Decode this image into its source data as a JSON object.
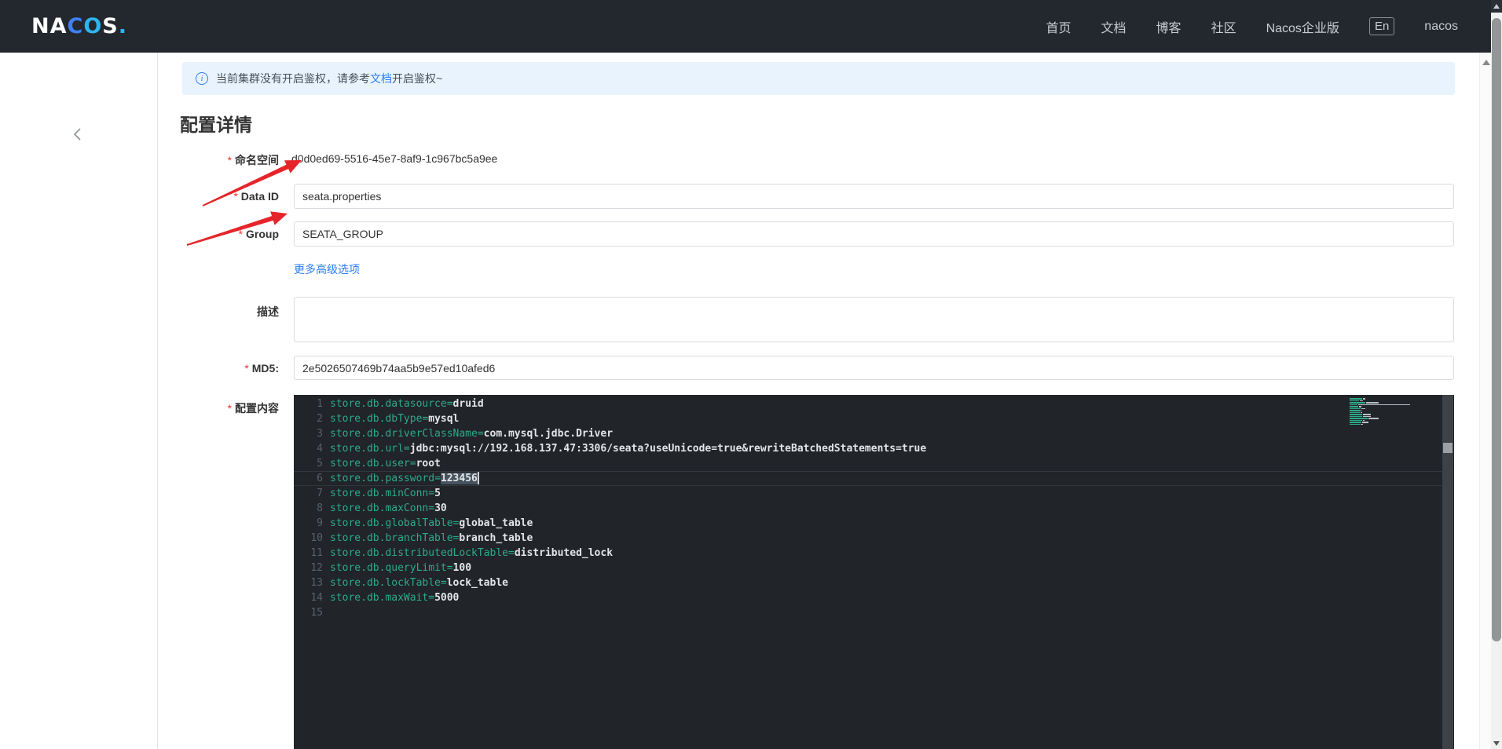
{
  "header": {
    "logo_parts": [
      {
        "text": "NA",
        "color": "#ffffff"
      },
      {
        "text": "C",
        "color": "#4080f5"
      },
      {
        "text": "O",
        "color": "#30b3ef"
      },
      {
        "text": "S",
        "color": "#ffffff"
      },
      {
        "text": ".",
        "color": "#30b3ef"
      }
    ],
    "nav": [
      {
        "label": "首页",
        "boxed": false
      },
      {
        "label": "文档",
        "boxed": false
      },
      {
        "label": "博客",
        "boxed": false
      },
      {
        "label": "社区",
        "boxed": false
      },
      {
        "label": "Nacos企业版",
        "boxed": false
      },
      {
        "label": "En",
        "boxed": true
      },
      {
        "label": "nacos",
        "boxed": false
      }
    ]
  },
  "alert": {
    "text_before": "当前集群没有开启鉴权，请参考",
    "link": "文档",
    "text_after": "开启鉴权~",
    "icon": "info-circle-icon"
  },
  "page": {
    "title": "配置详情"
  },
  "form": {
    "namespace": {
      "label": "命名空间",
      "required": true,
      "value": "d0d0ed69-5516-45e7-8af9-1c967bc5a9ee"
    },
    "data_id": {
      "label": "Data ID",
      "required": true,
      "value": "seata.properties"
    },
    "group": {
      "label": "Group",
      "required": true,
      "value": "SEATA_GROUP"
    },
    "more_options_link": "更多高级选项",
    "description": {
      "label": "描述",
      "required": false,
      "value": ""
    },
    "md5": {
      "label": "MD5:",
      "required": true,
      "value": "2e5026507469b74aa5b9e57ed10afed6"
    },
    "content": {
      "label": "配置内容",
      "required": true
    }
  },
  "editor": {
    "lines": [
      {
        "key": "store.db.datasource",
        "value": "druid"
      },
      {
        "key": "store.db.dbType",
        "value": "mysql"
      },
      {
        "key": "store.db.driverClassName",
        "value": "com.mysql.jdbc.Driver"
      },
      {
        "key": "store.db.url",
        "value": "jdbc:mysql://192.168.137.47:3306/seata?useUnicode=true&rewriteBatchedStatements=true"
      },
      {
        "key": "store.db.user",
        "value": "root"
      },
      {
        "key": "store.db.password",
        "value": "123456"
      },
      {
        "key": "store.db.minConn",
        "value": "5"
      },
      {
        "key": "store.db.maxConn",
        "value": "30"
      },
      {
        "key": "store.db.globalTable",
        "value": "global_table"
      },
      {
        "key": "store.db.branchTable",
        "value": "branch_table"
      },
      {
        "key": "store.db.distributedLockTable",
        "value": "distributed_lock"
      },
      {
        "key": "store.db.queryLimit",
        "value": "100"
      },
      {
        "key": "store.db.lockTable",
        "value": "lock_table"
      },
      {
        "key": "store.db.maxWait",
        "value": "5000"
      },
      {
        "key": "",
        "value": ""
      }
    ],
    "selection": {
      "line": 6,
      "selected_text": "123456"
    }
  },
  "colors": {
    "header_bg": "#23282e",
    "link_accent": "#2d7cf7",
    "alert_bg": "#e8f3fd",
    "required_star": "#f53131",
    "editor_bg": "#212428",
    "editor_key": "#2dab8c",
    "editor_value": "#e3e5e8",
    "editor_selection": "#46525f",
    "annotation_arrow": "#e5252a"
  }
}
